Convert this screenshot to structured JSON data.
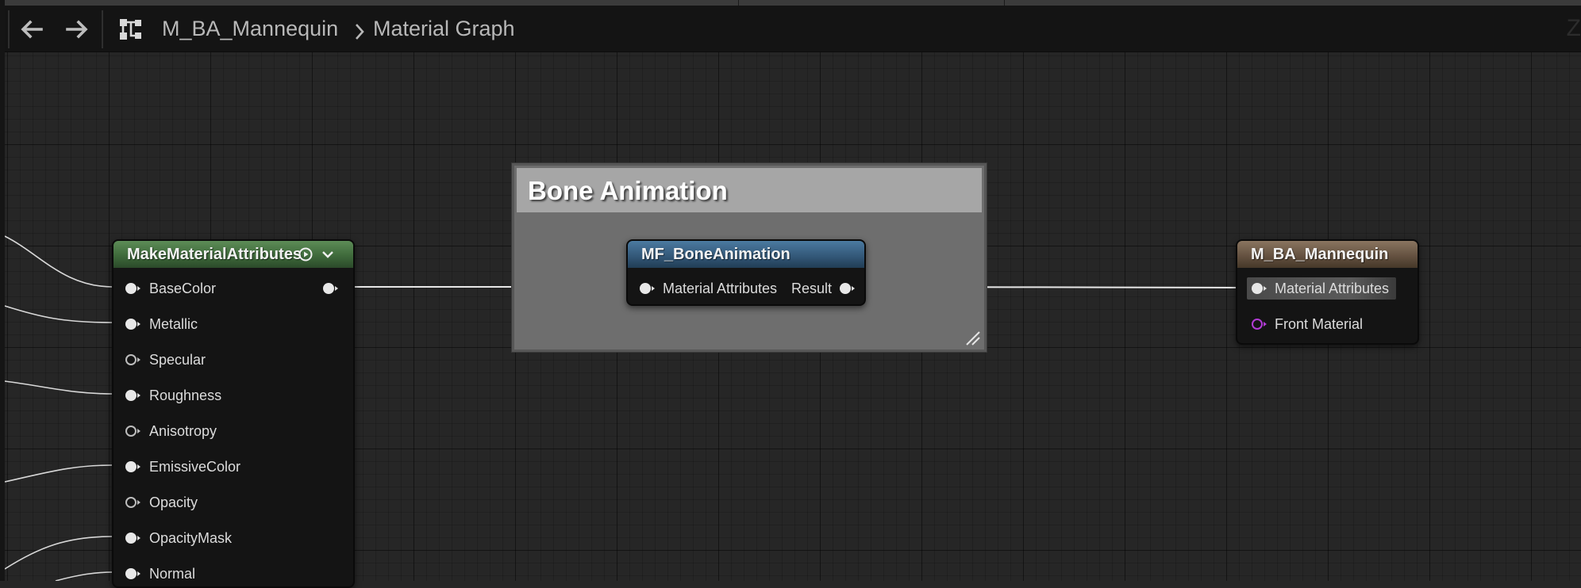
{
  "toolbar": {
    "breadcrumb": {
      "asset": "M_BA_Mannequin",
      "graph": "Material Graph"
    },
    "zoom_partial": "Z"
  },
  "comment": {
    "title": "Bone Animation"
  },
  "nodes": {
    "make_material_attributes": {
      "title": "MakeMaterialAttributes",
      "header_color": "#4e7a4a",
      "pins": [
        {
          "label": "BaseColor",
          "style": "filled"
        },
        {
          "label": "Metallic",
          "style": "filled"
        },
        {
          "label": "Specular",
          "style": "hollow"
        },
        {
          "label": "Roughness",
          "style": "filled"
        },
        {
          "label": "Anisotropy",
          "style": "hollow"
        },
        {
          "label": "EmissiveColor",
          "style": "filled"
        },
        {
          "label": "Opacity",
          "style": "hollow"
        },
        {
          "label": "OpacityMask",
          "style": "filled"
        },
        {
          "label": "Normal",
          "style": "filled"
        }
      ]
    },
    "mf_bone_animation": {
      "title": "MF_BoneAnimation",
      "header_color": "#3d6484",
      "input_label": "Material Attributes",
      "output_label": "Result"
    },
    "m_ba_mannequin": {
      "title": "M_BA_Mannequin",
      "header_color": "#7a6550",
      "pins": [
        {
          "label": "Material Attributes",
          "style": "filled"
        },
        {
          "label": "Front Material",
          "style": "purple"
        }
      ]
    }
  },
  "colors": {
    "graph_background": "#262626",
    "wire": "#e6e6e6",
    "comment_body": "#6e6e6e",
    "comment_header": "#a6a6a6"
  }
}
